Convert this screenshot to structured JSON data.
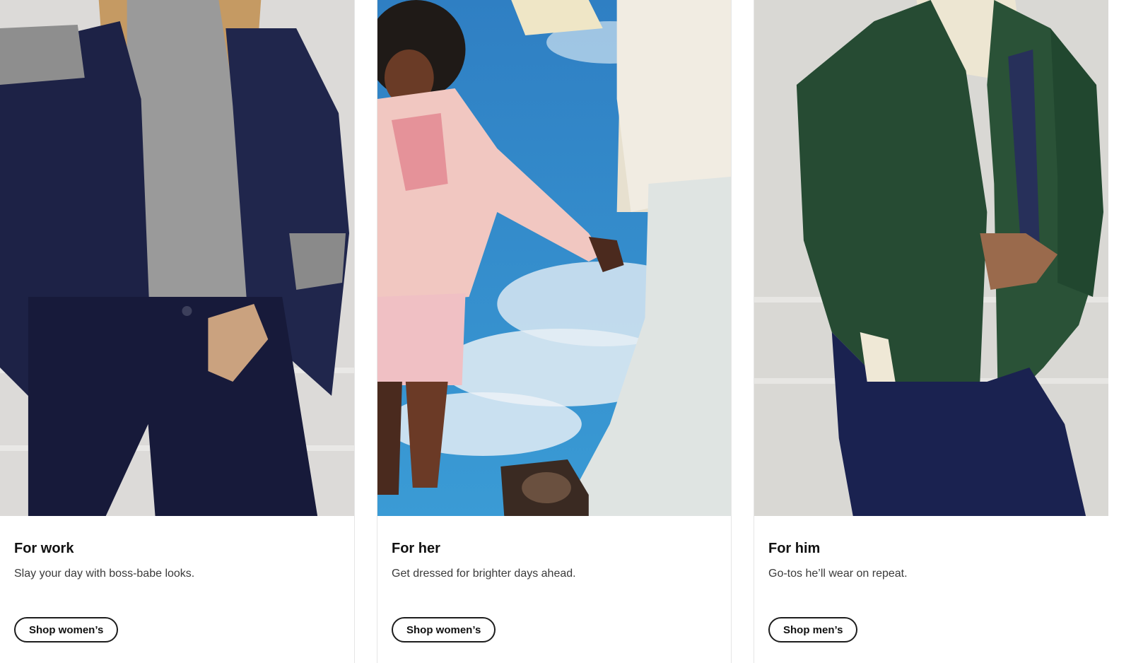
{
  "cards": [
    {
      "title": "For work",
      "description": "Slay your day with boss-babe looks.",
      "button_label": "Shop women’s",
      "image_subject": "woman in navy corduroy blazer and grey turtleneck"
    },
    {
      "title": "For her",
      "description": "Get dressed for brighter days ahead.",
      "button_label": "Shop women’s",
      "image_subject": "two women in pink hoodie and light denim against blue sky"
    },
    {
      "title": "For him",
      "description": "Go-tos he’ll wear on repeat.",
      "button_label": "Shop men’s",
      "image_subject": "man in green quilted jacket and navy trousers"
    }
  ],
  "colors": {
    "button_border": "#1d1d1d",
    "text": "#111111",
    "muted_text": "#3a3a3a",
    "divider": "#e6e6e6"
  }
}
